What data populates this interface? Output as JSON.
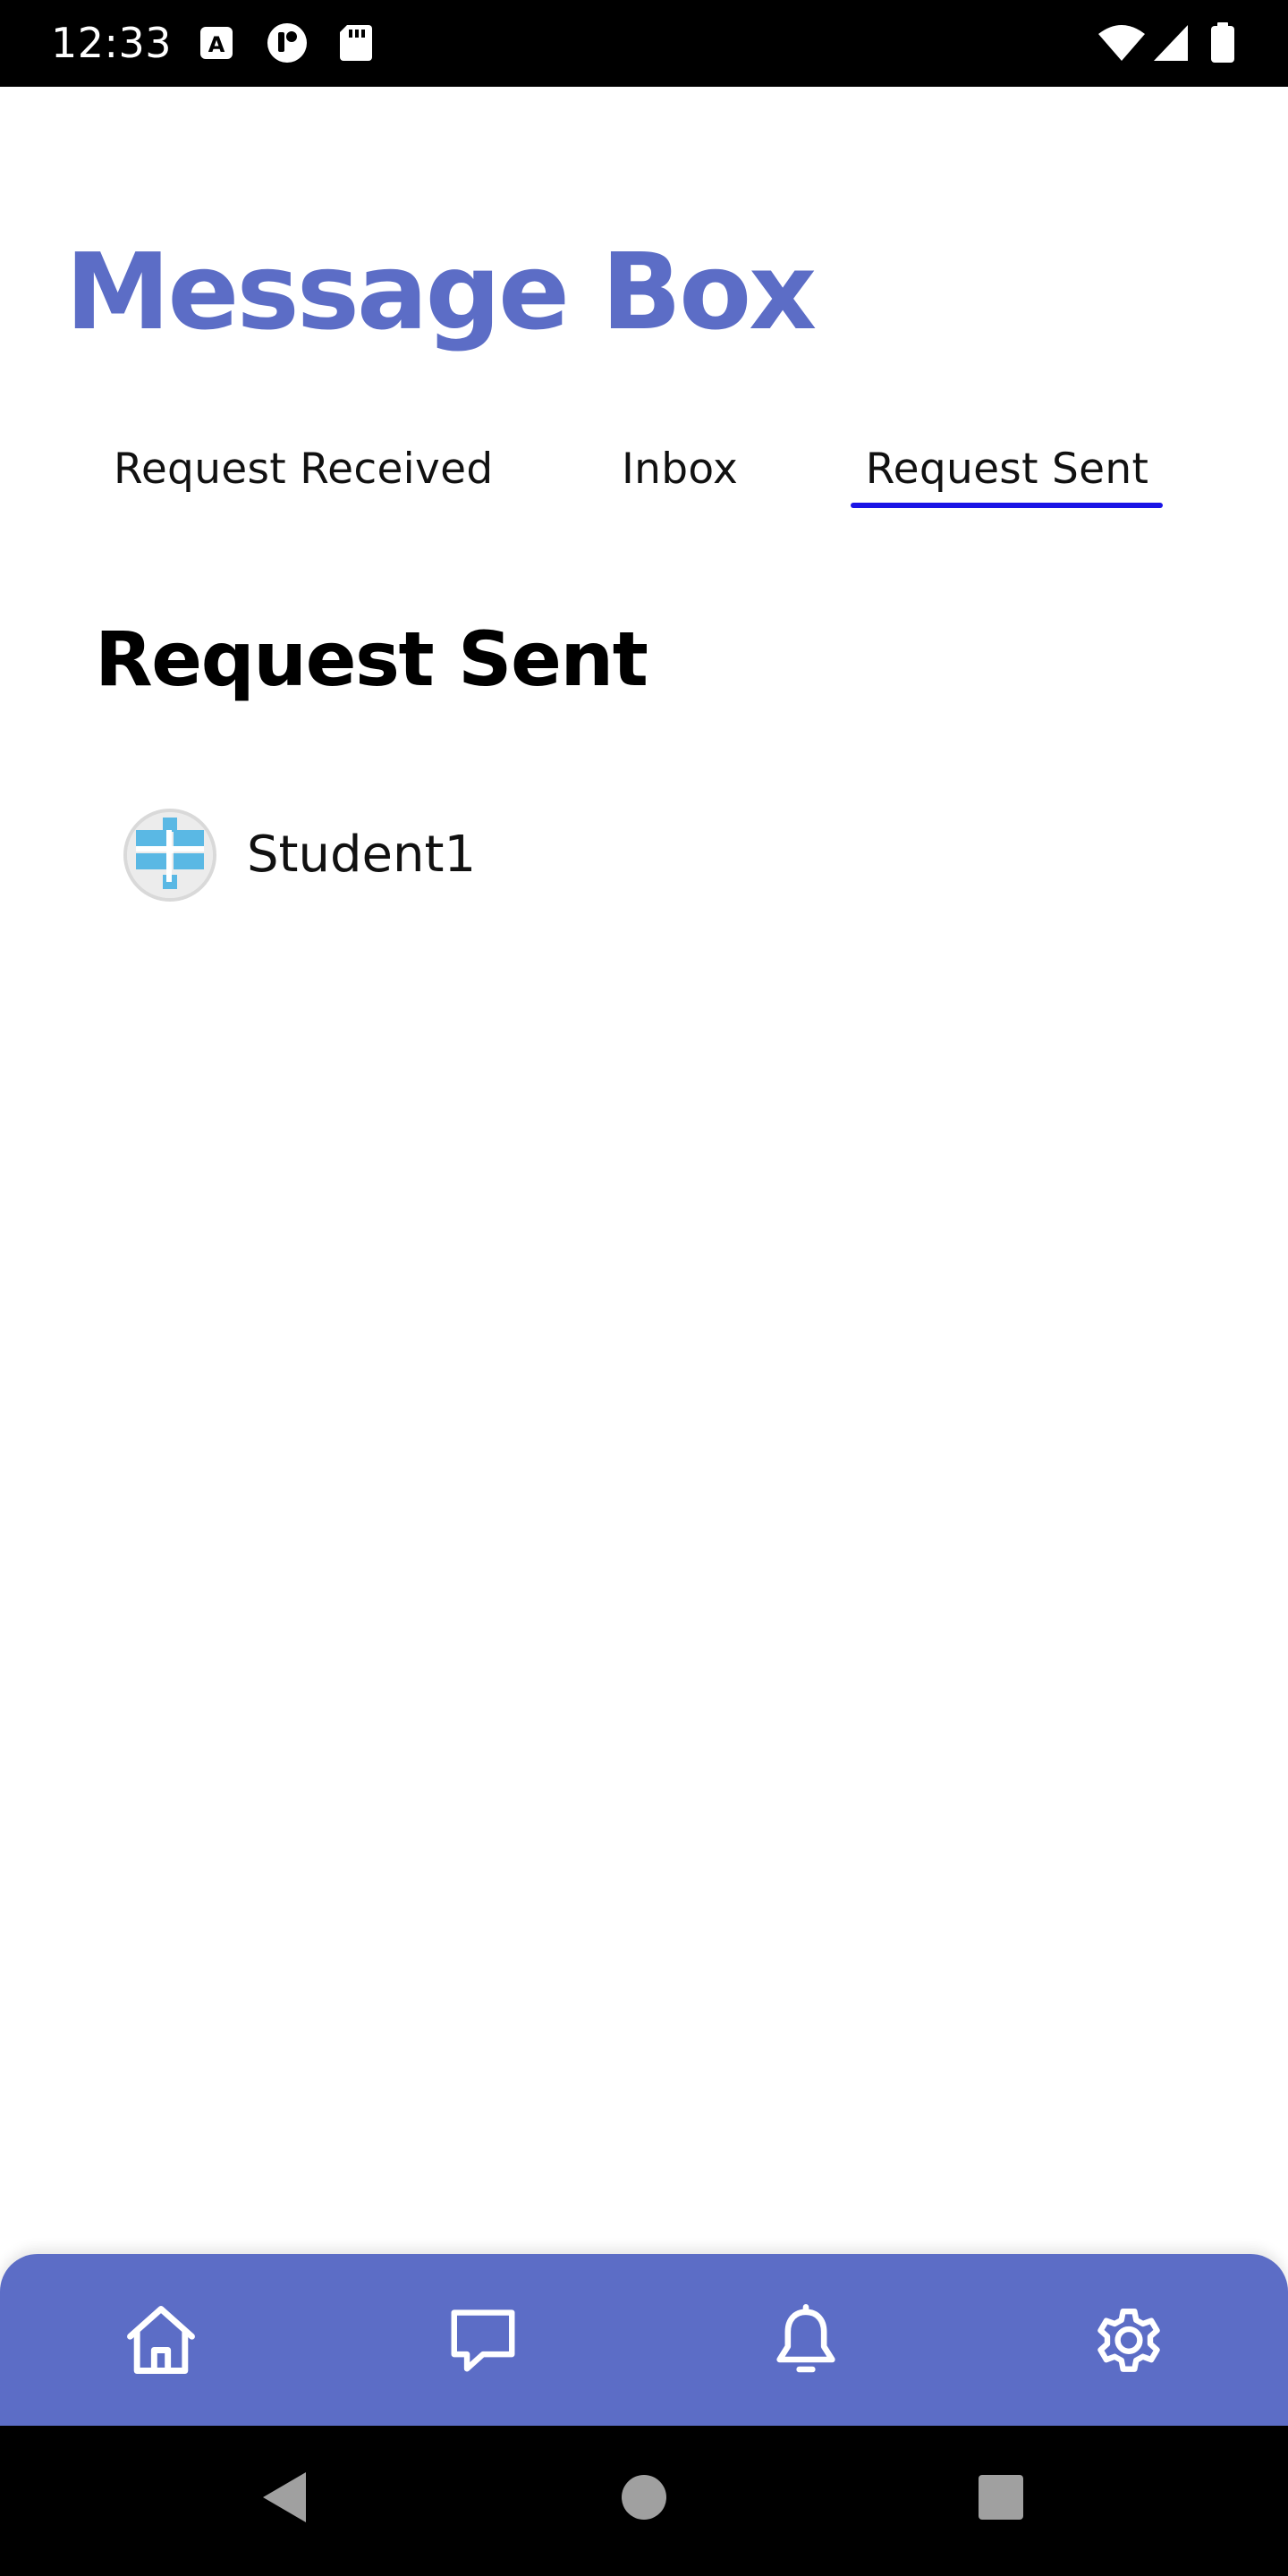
{
  "status_bar": {
    "time": "12:33",
    "left_icons": [
      "font-a-icon",
      "circle-app-icon",
      "sd-card-icon"
    ],
    "right_icons": [
      "wifi-icon",
      "signal-icon",
      "battery-icon"
    ]
  },
  "header": {
    "title": "Message Box"
  },
  "tabs": [
    {
      "label": "Request Received",
      "selected": false
    },
    {
      "label": "Inbox",
      "selected": false
    },
    {
      "label": "Request Sent",
      "selected": true
    }
  ],
  "section": {
    "title": "Request Sent",
    "items": [
      {
        "name": "Student1",
        "avatar": "avatar-image"
      }
    ]
  },
  "bottom_nav": {
    "items": [
      "home-icon",
      "chat-icon",
      "bell-icon",
      "gear-icon"
    ],
    "background": "#5c6dc6",
    "icon_color": "#ffffff"
  },
  "system_nav": {
    "items": [
      "back-icon",
      "home-circle-icon",
      "recents-icon"
    ]
  },
  "colors": {
    "accent": "#5c6dc6",
    "tab_indicator": "#1a14e6",
    "text": "#111111"
  }
}
